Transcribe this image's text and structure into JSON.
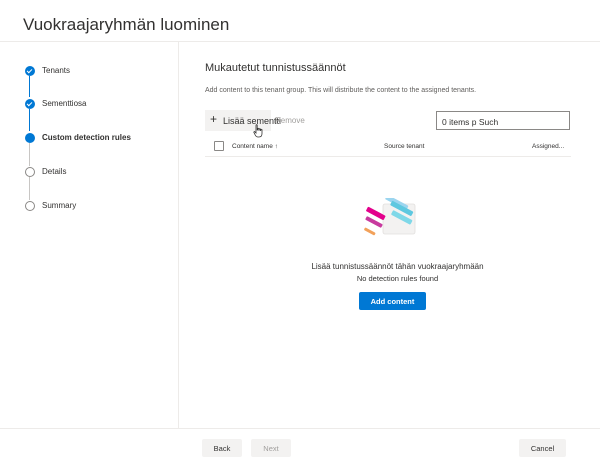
{
  "window": {
    "title": "Vuokraajaryhmän luominen"
  },
  "wizard": {
    "steps": [
      {
        "label": "Tenants",
        "state": "done"
      },
      {
        "label": "Sementtiosa",
        "state": "done"
      },
      {
        "label": "Custom detection rules",
        "state": "current"
      },
      {
        "label": "Details",
        "state": "todo"
      },
      {
        "label": "Summary",
        "state": "todo"
      }
    ]
  },
  "main": {
    "title": "Mukautetut tunnistussäännöt",
    "description": "Add content to this tenant group. This will distribute the content to the assigned tenants.",
    "toolbar": {
      "add_label": "Lisää sementti",
      "remove_label": "Remove"
    },
    "search": {
      "value": "0 items p Such"
    },
    "table": {
      "columns": [
        "Content name",
        "Source tenant",
        "Assigned..."
      ],
      "sort_indicator": "↑"
    },
    "empty_state": {
      "title": "Lisää tunnistussäännöt tähän vuokraajaryhmään",
      "subtitle": "No detection rules found",
      "button_label": "Add content"
    }
  },
  "footer": {
    "back_label": "Back",
    "next_label": "Next",
    "cancel_label": "Cancel"
  },
  "colors": {
    "accent": "#0078d4",
    "border": "#edebe9",
    "button_bg": "#f3f2f1",
    "disabled_text": "#a19f9d"
  }
}
